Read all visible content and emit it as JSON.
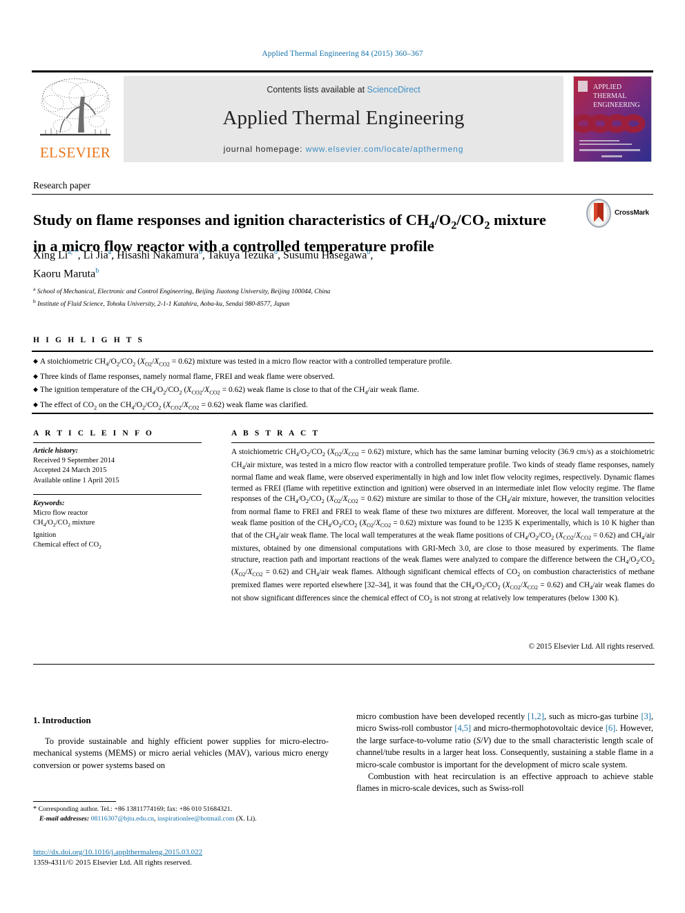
{
  "running_head": "Applied Thermal Engineering 84 (2015) 360–367",
  "masthead": {
    "contents_prefix": "Contents lists available at ",
    "sciencedirect": "ScienceDirect",
    "journal_title": "Applied Thermal Engineering",
    "homepage_prefix": "journal homepage: ",
    "homepage_url": "www.elsevier.com/locate/apthermeng",
    "publisher": "ELSEVIER",
    "cover_lines": [
      "APPLIED",
      "THERMAL",
      "ENGINEERING"
    ]
  },
  "article": {
    "type": "Research paper",
    "title_line1": "Study on flame responses and ignition characteristics of CH",
    "title": "Study on flame responses and ignition characteristics of CH4/O2/CO2 mixture in a micro flow reactor with a controlled temperature profile",
    "crossmark_label": "CrossMark",
    "authors": [
      {
        "name": "Xing Li",
        "sup": "a, *"
      },
      {
        "name": "Li Jia",
        "sup": "a"
      },
      {
        "name": "Hisashi Nakamura",
        "sup": "b"
      },
      {
        "name": "Takuya Tezuka",
        "sup": "b"
      },
      {
        "name": "Susumu Hasegawa",
        "sup": "b"
      },
      {
        "name": "Kaoru Maruta",
        "sup": "b"
      }
    ],
    "affiliations": [
      {
        "mark": "a",
        "text": "School of Mechanical, Electronic and Control Engineering, Beijing Jiaotong University, Beijing 100044, China"
      },
      {
        "mark": "b",
        "text": "Institute of Fluid Science, Tohoku University, 2-1-1 Katahira, Aoba-ku, Sendai 980-8577, Japan"
      }
    ]
  },
  "highlights": {
    "label": "H I G H L I G H T S",
    "items": [
      "A stoichiometric CH4/O2/CO2 (XO2/XCO2 = 0.62) mixture was tested in a micro flow reactor with a controlled temperature profile.",
      "Three kinds of flame responses, namely normal flame, FREI and weak flame were observed.",
      "The ignition temperature of the CH4/O2/CO2 (XCO2/XCO2 = 0.62) weak flame is close to that of the CH4/air weak flame.",
      "The effect of CO2 on the CH4/O2/CO2 (XCO2/XCO2 = 0.62) weak flame was clarified."
    ]
  },
  "article_info": {
    "label": "A R T I C L E   I N F O",
    "history_heading": "Article history:",
    "history": [
      "Received 9 September 2014",
      "Accepted 24 March 2015",
      "Available online 1 April 2015"
    ],
    "keywords_heading": "Keywords:",
    "keywords": [
      "Micro flow reactor",
      "CH4/O2/CO2 mixture",
      "Ignition",
      "Chemical effect of CO2"
    ]
  },
  "abstract": {
    "label": "A B S T R A C T",
    "text": "A stoichiometric CH4/O2/CO2 (XO2/XCO2 = 0.62) mixture, which has the same laminar burning velocity (36.9 cm/s) as a stoichiometric CH4/air mixture, was tested in a micro flow reactor with a controlled temperature profile. Two kinds of steady flame responses, namely normal flame and weak flame, were observed experimentally in high and low inlet flow velocity regimes, respectively. Dynamic flames termed as FREI (flame with repetitive extinction and ignition) were observed in an intermediate inlet flow velocity regime. The flame responses of the CH4/O2/CO2 (XO2/XCO2 = 0.62) mixture are similar to those of the CH4/air mixture, however, the transition velocities from normal flame to FREI and FREI to weak flame of these two mixtures are different. Moreover, the local wall temperature at the weak flame position of the CH4/O2/CO2 (XO2/XCO2 = 0.62) mixture was found to be 1235 K experimentally, which is 10 K higher than that of the CH4/air weak flame. The local wall temperatures at the weak flame positions of CH4/O2/CO2 (XCO2/XCO2 = 0.62) and CH4/air mixtures, obtained by one dimensional computations with GRI-Mech 3.0, are close to those measured by experiments. The flame structure, reaction path and important reactions of the weak flames were analyzed to compare the difference between the CH4/O2/CO2 (XO2/XCO2 = 0.62) and CH4/air weak flames. Although significant chemical effects of CO2 on combustion characteristics of methane premixed flames were reported elsewhere [32–34], it was found that the CH4/O2/CO2 (XCO2/XCO2 = 0.62) and CH4/air weak flames do not show significant differences since the chemical effect of CO2 is not strong at relatively low temperatures (below 1300 K).",
    "copyright": "© 2015 Elsevier Ltd. All rights reserved."
  },
  "body": {
    "section_number": "1.",
    "section_title": "Introduction",
    "left_paragraph": "To provide sustainable and highly efficient power supplies for micro-electro-mechanical systems (MEMS) or micro aerial vehicles (MAV), various micro energy conversion or power systems based on",
    "right_paragraph_1_parts": [
      "micro combustion have been developed recently ",
      "[1,2]",
      ", such as micro-gas turbine ",
      "[3]",
      ", micro Swiss-roll combustor ",
      "[4,5]",
      " and micro-thermophotovoltaic device ",
      "[6]",
      ". However, the large surface-to-volume ratio (S/V) due to the small characteristic length scale of channel/tube results in a larger heat loss. Consequently, sustaining a stable flame in a micro-scale combustor is important for the development of micro scale system."
    ],
    "right_paragraph_2": "Combustion with heat recirculation is an effective approach to achieve stable flames in micro-scale devices, such as Swiss-roll"
  },
  "footnotes": {
    "corresponding": "Corresponding author. Tel.: +86 13811774169; fax: +86 010 51684321.",
    "email_label": "E-mail addresses:",
    "email_1": "08116307@bjtu.edu.cn",
    "email_2": "inspirationlee@hotmail.com",
    "email_suffix": "(X. Li).",
    "doi": "http://dx.doi.org/10.1016/j.applthermaleng.2015.03.022",
    "issn_line": "1359-4311/© 2015 Elsevier Ltd. All rights reserved."
  },
  "colors": {
    "link": "#1471a8",
    "sd_link": "#3d8dc4",
    "elsevier_orange": "#e8751a",
    "band_gray": "#e7e7e7"
  }
}
